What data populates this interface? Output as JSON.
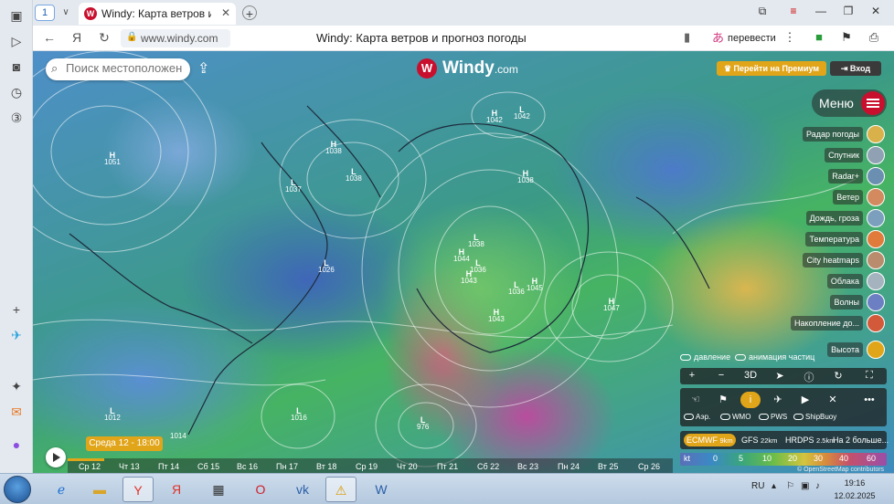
{
  "browser": {
    "tab_count": "1",
    "tab_title": "Windy: Карта ветров и",
    "url": "www.windy.com",
    "page_title": "Windy: Карта ветров и прогноз погоды",
    "translate_label": "перевести"
  },
  "windy": {
    "search_placeholder": "Поиск местоположен",
    "logo_text": "Windy",
    "logo_suffix": ".com",
    "premium_label": "Перейти на Премиум",
    "login_label": "Вход",
    "menu_label": "Меню",
    "layers": [
      {
        "label": "Радар погоды",
        "color": "#d9b14a"
      },
      {
        "label": "Спутник",
        "color": "#8fa1b3"
      },
      {
        "label": "Radar+",
        "color": "#6b8fb0"
      },
      {
        "label": "Ветер",
        "color": "#d28a5e"
      },
      {
        "label": "Дождь, гроза",
        "color": "#7c9fbe"
      },
      {
        "label": "Температура",
        "color": "#e07b3c"
      },
      {
        "label": "City heatmaps",
        "color": "#b88c6c"
      },
      {
        "label": "Облака",
        "color": "#a5b3bf"
      },
      {
        "label": "Волны",
        "color": "#6c7fc2"
      },
      {
        "label": "Накопление до...",
        "color": "#d25a3a"
      },
      {
        "label": "Высота",
        "color": "#e1a51a"
      }
    ],
    "toggle_pressure": "давление",
    "toggle_particles": "анимация частиц",
    "ctrl_3d": "3D",
    "obs_airports": "Аэр.",
    "obs_wmo": "WMO",
    "obs_pws": "PWS",
    "obs_shipbuoy": "ShipBuoy",
    "models": [
      {
        "name": "ECMWF",
        "res": "9km"
      },
      {
        "name": "GFS",
        "res": "22km"
      },
      {
        "name": "HRDPS",
        "res": "2.5km"
      },
      {
        "name": "На 2 больше...",
        "res": ""
      }
    ],
    "scale_unit": "kt",
    "scale_values": [
      "0",
      "5",
      "10",
      "20",
      "30",
      "40",
      "60"
    ],
    "attribution": "© OpenStreetMap contributors",
    "time_badge": "Среда 12 - 18:00",
    "timeline_days": [
      "Ср 12",
      "Чт 13",
      "Пт 14",
      "Сб 15",
      "Вс 16",
      "Пн 17",
      "Вт 18",
      "Ср 19",
      "Чт 20",
      "Пт 21",
      "Сб 22",
      "Вс 23",
      "Пн 24",
      "Вт 25",
      "Ср 26"
    ],
    "pressure_labels": [
      {
        "type": "H",
        "value": "1051"
      },
      {
        "type": "H",
        "value": "1042"
      },
      {
        "type": "L",
        "value": "1042"
      },
      {
        "type": "H",
        "value": "1038"
      },
      {
        "type": "L",
        "value": "1038"
      },
      {
        "type": "L",
        "value": "1037"
      },
      {
        "type": "L",
        "value": "1026"
      },
      {
        "type": "H",
        "value": "1038"
      },
      {
        "type": "L",
        "value": "1038"
      },
      {
        "type": "H",
        "value": "1044"
      },
      {
        "type": "L",
        "value": "1036"
      },
      {
        "type": "H",
        "value": "1043"
      },
      {
        "type": "L",
        "value": "1036"
      },
      {
        "type": "H",
        "value": "1045"
      },
      {
        "type": "H",
        "value": "1043"
      },
      {
        "type": "H",
        "value": "1047"
      },
      {
        "type": "L",
        "value": "1016"
      },
      {
        "type": "L",
        "value": "1012"
      },
      {
        "type": "L",
        "value": "976"
      },
      {
        "type": "",
        "value": "1014"
      }
    ]
  },
  "taskbar": {
    "lang": "RU",
    "time": "19:16",
    "date": "12.02.2025"
  }
}
